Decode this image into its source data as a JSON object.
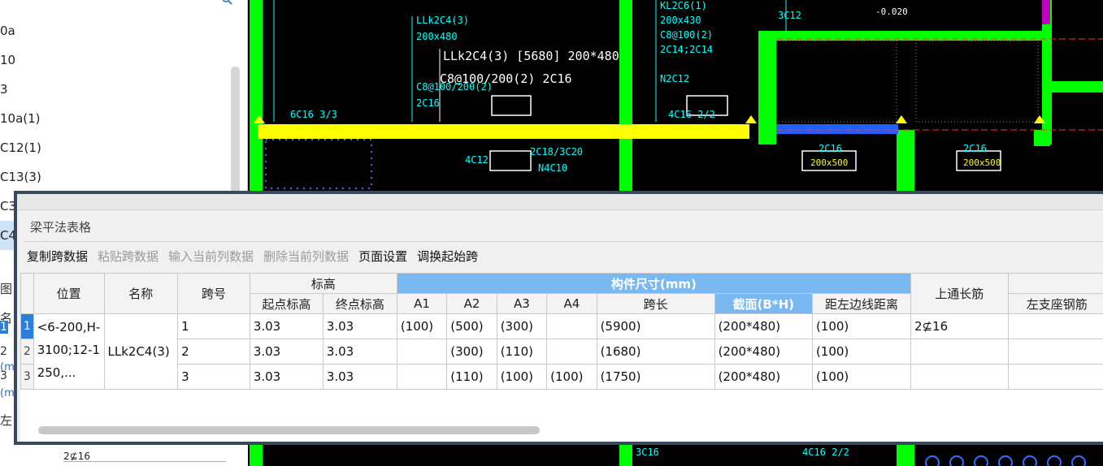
{
  "left_list": {
    "items": [
      {
        "label": "0a"
      },
      {
        "label": "10"
      },
      {
        "label": "3"
      },
      {
        "label": "10a(1)"
      },
      {
        "label": "C12(1)"
      },
      {
        "label": "C13(3)"
      },
      {
        "label": "C3"
      },
      {
        "label": "C4"
      }
    ],
    "hidden_labels": [
      "图",
      "名",
      "1",
      "2",
      "3",
      "(m",
      "(m",
      "左"
    ],
    "bottom_value": "2⊈16"
  },
  "cad": {
    "beam_label_line1": "LLk2C4(3) [5680] 200*480",
    "beam_label_line2": "C8@100/200(2) 2C16",
    "texts": [
      "LLk2C4(3)",
      "200x480",
      "C8@100/200(2)",
      "2C16",
      "KL2C6(1)",
      "200x430",
      "C8@100(2)",
      "2C14;2C14",
      "N2C12",
      "4C16 2/2",
      "6C16 3/3",
      "2C18/3C20",
      "N4C10",
      "4C12",
      "2C16",
      "200x500",
      "2C16",
      "200x500",
      "4C16 2/2",
      "3C16",
      "-0.020",
      "3C12"
    ]
  },
  "dialog": {
    "title": "梁平法表格",
    "toolbar": [
      {
        "label": "复制跨数据",
        "enabled": true
      },
      {
        "label": "粘贴跨数据",
        "enabled": false
      },
      {
        "label": "输入当前列数据",
        "enabled": false
      },
      {
        "label": "删除当前列数据",
        "enabled": false
      },
      {
        "label": "页面设置",
        "enabled": true
      },
      {
        "label": "调换起始跨",
        "enabled": true
      }
    ],
    "grid": {
      "headers": {
        "position": "位置",
        "name": "名称",
        "span_no": "跨号",
        "elevation": "标高",
        "start_elev": "起点标高",
        "end_elev": "终点标高",
        "dims_group": "构件尺寸(mm)",
        "a1": "A1",
        "a2": "A2",
        "a3": "A3",
        "a4": "A4",
        "span_len": "跨长",
        "section": "截面(B*H)",
        "dist_left": "距左边线距离",
        "top_rebar": "上通长筋",
        "left_seat": "左支座钢筋"
      },
      "position_value": "<6-200,H-3100;12-1250,...",
      "name_value": "LLk2C4(3)",
      "rows": [
        {
          "row_no": "1",
          "span": "1",
          "start": "3.03",
          "end": "3.03",
          "a1": "(100)",
          "a2": "(500)",
          "a3": "(300)",
          "a4": "",
          "span_len": "(5900)",
          "section": "(200*480)",
          "dist": "(100)",
          "top": "2⊈16",
          "left": ""
        },
        {
          "row_no": "2",
          "span": "2",
          "start": "3.03",
          "end": "3.03",
          "a1": "",
          "a2": "(300)",
          "a3": "(110)",
          "a4": "",
          "span_len": "(1680)",
          "section": "(200*480)",
          "dist": "(100)",
          "top": "",
          "left": ""
        },
        {
          "row_no": "3",
          "span": "3",
          "start": "3.03",
          "end": "3.03",
          "a1": "",
          "a2": "(110)",
          "a3": "(100)",
          "a4": "(100)",
          "span_len": "(1750)",
          "section": "(200*480)",
          "dist": "(100)",
          "top": "",
          "left": ""
        }
      ]
    }
  },
  "colors": {
    "cad_background": "#000000",
    "beam_yellow": "#ffff00",
    "column_green": "#00ff00",
    "header_blue": "#7ab8f2",
    "selected_row": "#2b7fd6"
  }
}
